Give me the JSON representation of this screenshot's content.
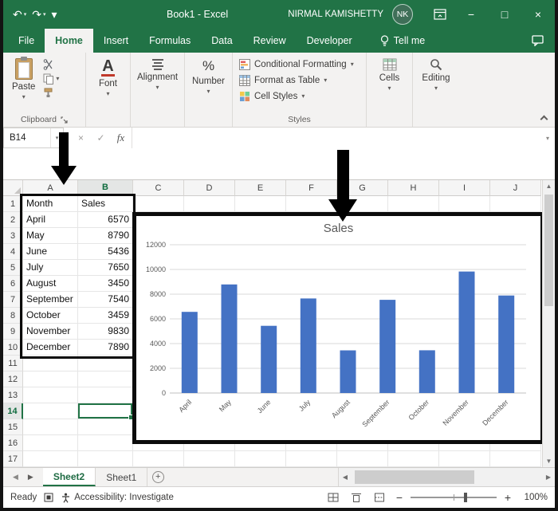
{
  "colors": {
    "accent_green": "#217346",
    "bar_blue": "#4472C4"
  },
  "window": {
    "title": "Book1 - Excel",
    "user_name": "NIRMAL KAMISHETTY",
    "user_initials": "NK",
    "controls": {
      "minimize": "−",
      "maximize": "□",
      "close": "×"
    }
  },
  "quick_access": {
    "undo": "↶",
    "redo": "↷",
    "customize": "▾"
  },
  "ribbon_tabs": {
    "tabs": [
      {
        "label": "File",
        "active": false
      },
      {
        "label": "Home",
        "active": true
      },
      {
        "label": "Insert",
        "active": false
      },
      {
        "label": "Formulas",
        "active": false
      },
      {
        "label": "Data",
        "active": false
      },
      {
        "label": "Review",
        "active": false
      },
      {
        "label": "Developer",
        "active": false
      }
    ],
    "tell_me": "Tell me"
  },
  "ribbon": {
    "paste": "Paste",
    "font": "Font",
    "alignment": "Alignment",
    "number": "Number",
    "styles_items": [
      "Conditional Formatting",
      "Format as Table",
      "Cell Styles"
    ],
    "cells": "Cells",
    "editing": "Editing",
    "group_labels": {
      "clipboard": "Clipboard",
      "styles": "Styles"
    }
  },
  "formula_bar": {
    "name_box": "B14",
    "fx_label": "fx"
  },
  "grid": {
    "columns": [
      "A",
      "B",
      "C",
      "D",
      "E",
      "F",
      "G",
      "H",
      "I",
      "J"
    ],
    "row_count": 17,
    "cell_rows": [
      [
        "Month",
        "Sales"
      ],
      [
        "April",
        "6570"
      ],
      [
        "May",
        "8790"
      ],
      [
        "June",
        "5436"
      ],
      [
        "July",
        "7650"
      ],
      [
        "August",
        "3450"
      ],
      [
        "September",
        "7540"
      ],
      [
        "October",
        "3459"
      ],
      [
        "November",
        "9830"
      ],
      [
        "December",
        "7890"
      ]
    ],
    "selected_cell": "B14"
  },
  "sheet_bar": {
    "tabs": [
      {
        "label": "Sheet2",
        "active": true
      },
      {
        "label": "Sheet1",
        "active": false
      }
    ],
    "add_sheet": "+"
  },
  "status_bar": {
    "mode": "Ready",
    "accessibility": "Accessibility: Investigate",
    "zoom": "100%"
  },
  "chart_data": {
    "type": "bar",
    "title": "Sales",
    "categories": [
      "April",
      "May",
      "June",
      "July",
      "August",
      "September",
      "October",
      "November",
      "December"
    ],
    "values": [
      6570,
      8790,
      5436,
      7650,
      3450,
      7540,
      3459,
      9830,
      7890
    ],
    "xlabel": "",
    "ylabel": "",
    "ylim": [
      0,
      12000
    ],
    "ytick": 2000,
    "bar_color": "#4472C4",
    "grid": true,
    "legend": "none"
  }
}
